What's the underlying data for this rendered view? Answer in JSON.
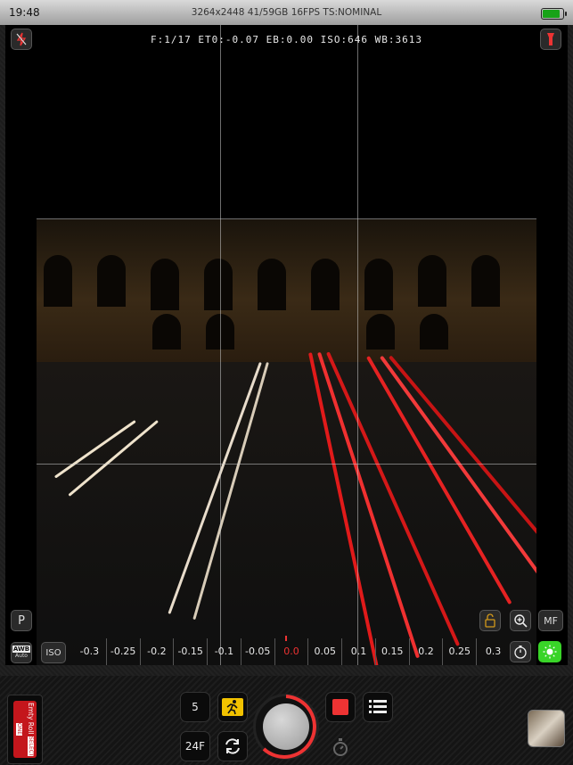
{
  "status": {
    "time": "19:48",
    "info": "3264x2448 41/59GB  16FPS TS:NOMINAL",
    "battery_level": 0.85
  },
  "readout": "F:1/17  ET0:-0.07  EB:0.00  ISO:646  WB:3613",
  "controls": {
    "mode": "P",
    "focus_mode": "MF",
    "wb_label": "AWB",
    "wb_sub": "Auto",
    "iso_label": "ISO"
  },
  "exposure_scale": [
    "-0.3",
    "-0.25",
    "-0.2",
    "-0.15",
    "-0.1",
    "-0.05",
    "0.0",
    "0.05",
    "0.1",
    "0.15",
    "0.2",
    "0.25",
    "0.3"
  ],
  "bottom": {
    "roll_label_1": "Emty Roll",
    "roll_label_2": "SELECT ONE",
    "count": "5",
    "frame_rate": "24F"
  },
  "colors": {
    "accent_red": "#e33333",
    "accent_green": "#39d428",
    "accent_yellow": "#f2c200"
  }
}
